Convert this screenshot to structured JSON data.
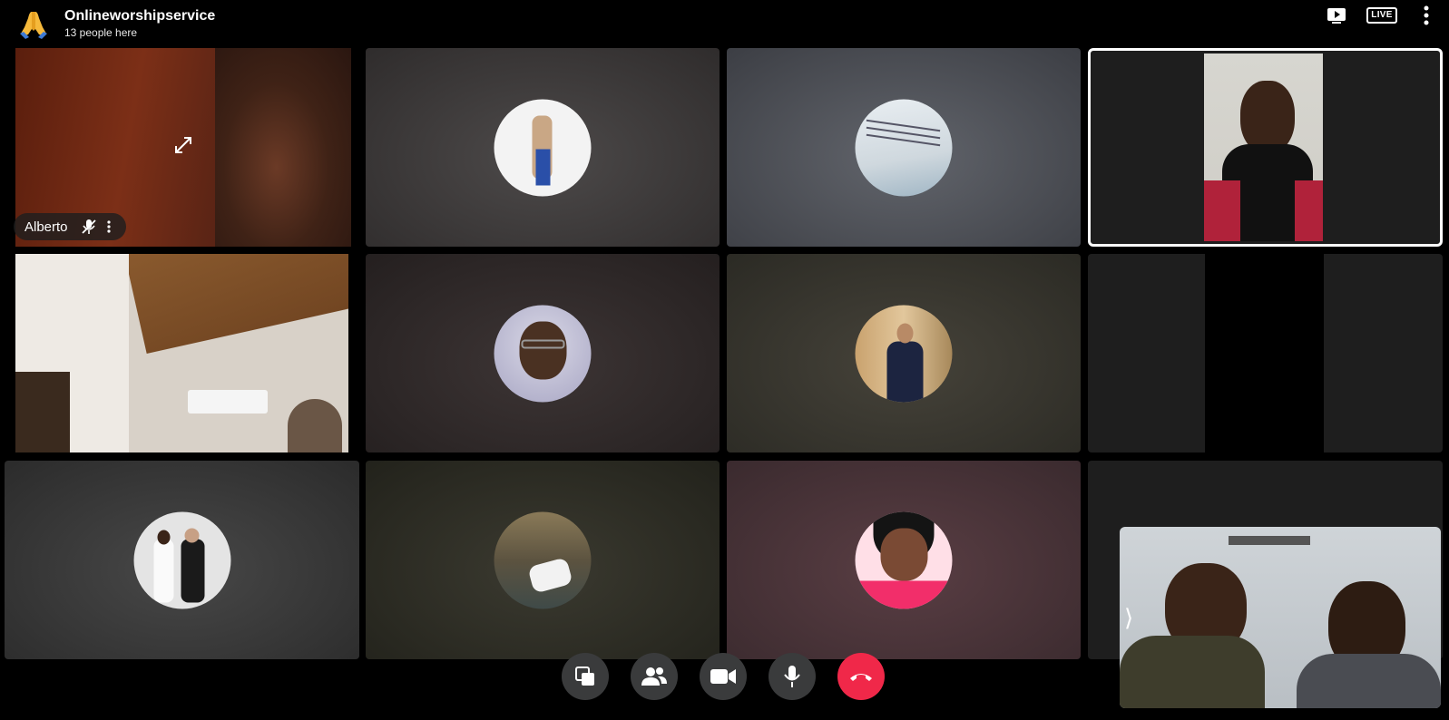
{
  "header": {
    "room_name": "Onlineworshipservice",
    "people_count": "13 people here",
    "room_icon": "praying-hands-emoji",
    "live_label": "LIVE"
  },
  "participants": [
    {
      "name": "Alberto"
    }
  ],
  "self_view": {
    "collapse_label": "⟩"
  },
  "colors": {
    "end_call": "#f02849",
    "control_bg": "#3a3b3c",
    "active_speaker_border": "#ffffff"
  }
}
